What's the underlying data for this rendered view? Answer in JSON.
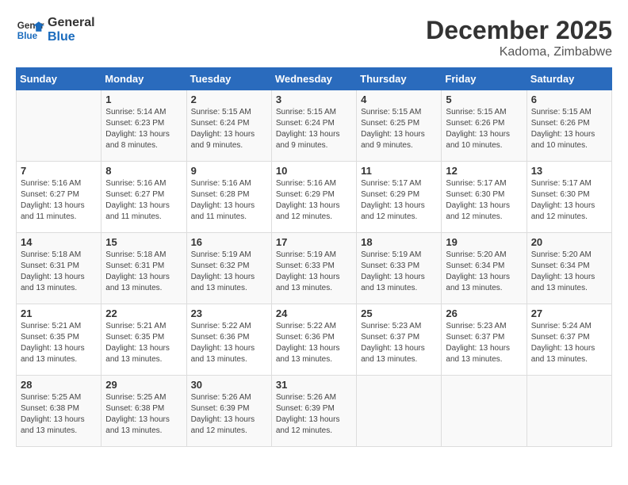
{
  "logo": {
    "line1": "General",
    "line2": "Blue"
  },
  "title": "December 2025",
  "location": "Kadoma, Zimbabwe",
  "days_header": [
    "Sunday",
    "Monday",
    "Tuesday",
    "Wednesday",
    "Thursday",
    "Friday",
    "Saturday"
  ],
  "weeks": [
    [
      {
        "day": "",
        "info": ""
      },
      {
        "day": "1",
        "info": "Sunrise: 5:14 AM\nSunset: 6:23 PM\nDaylight: 13 hours\nand 8 minutes."
      },
      {
        "day": "2",
        "info": "Sunrise: 5:15 AM\nSunset: 6:24 PM\nDaylight: 13 hours\nand 9 minutes."
      },
      {
        "day": "3",
        "info": "Sunrise: 5:15 AM\nSunset: 6:24 PM\nDaylight: 13 hours\nand 9 minutes."
      },
      {
        "day": "4",
        "info": "Sunrise: 5:15 AM\nSunset: 6:25 PM\nDaylight: 13 hours\nand 9 minutes."
      },
      {
        "day": "5",
        "info": "Sunrise: 5:15 AM\nSunset: 6:26 PM\nDaylight: 13 hours\nand 10 minutes."
      },
      {
        "day": "6",
        "info": "Sunrise: 5:15 AM\nSunset: 6:26 PM\nDaylight: 13 hours\nand 10 minutes."
      }
    ],
    [
      {
        "day": "7",
        "info": "Sunrise: 5:16 AM\nSunset: 6:27 PM\nDaylight: 13 hours\nand 11 minutes."
      },
      {
        "day": "8",
        "info": "Sunrise: 5:16 AM\nSunset: 6:27 PM\nDaylight: 13 hours\nand 11 minutes."
      },
      {
        "day": "9",
        "info": "Sunrise: 5:16 AM\nSunset: 6:28 PM\nDaylight: 13 hours\nand 11 minutes."
      },
      {
        "day": "10",
        "info": "Sunrise: 5:16 AM\nSunset: 6:29 PM\nDaylight: 13 hours\nand 12 minutes."
      },
      {
        "day": "11",
        "info": "Sunrise: 5:17 AM\nSunset: 6:29 PM\nDaylight: 13 hours\nand 12 minutes."
      },
      {
        "day": "12",
        "info": "Sunrise: 5:17 AM\nSunset: 6:30 PM\nDaylight: 13 hours\nand 12 minutes."
      },
      {
        "day": "13",
        "info": "Sunrise: 5:17 AM\nSunset: 6:30 PM\nDaylight: 13 hours\nand 12 minutes."
      }
    ],
    [
      {
        "day": "14",
        "info": "Sunrise: 5:18 AM\nSunset: 6:31 PM\nDaylight: 13 hours\nand 13 minutes."
      },
      {
        "day": "15",
        "info": "Sunrise: 5:18 AM\nSunset: 6:31 PM\nDaylight: 13 hours\nand 13 minutes."
      },
      {
        "day": "16",
        "info": "Sunrise: 5:19 AM\nSunset: 6:32 PM\nDaylight: 13 hours\nand 13 minutes."
      },
      {
        "day": "17",
        "info": "Sunrise: 5:19 AM\nSunset: 6:33 PM\nDaylight: 13 hours\nand 13 minutes."
      },
      {
        "day": "18",
        "info": "Sunrise: 5:19 AM\nSunset: 6:33 PM\nDaylight: 13 hours\nand 13 minutes."
      },
      {
        "day": "19",
        "info": "Sunrise: 5:20 AM\nSunset: 6:34 PM\nDaylight: 13 hours\nand 13 minutes."
      },
      {
        "day": "20",
        "info": "Sunrise: 5:20 AM\nSunset: 6:34 PM\nDaylight: 13 hours\nand 13 minutes."
      }
    ],
    [
      {
        "day": "21",
        "info": "Sunrise: 5:21 AM\nSunset: 6:35 PM\nDaylight: 13 hours\nand 13 minutes."
      },
      {
        "day": "22",
        "info": "Sunrise: 5:21 AM\nSunset: 6:35 PM\nDaylight: 13 hours\nand 13 minutes."
      },
      {
        "day": "23",
        "info": "Sunrise: 5:22 AM\nSunset: 6:36 PM\nDaylight: 13 hours\nand 13 minutes."
      },
      {
        "day": "24",
        "info": "Sunrise: 5:22 AM\nSunset: 6:36 PM\nDaylight: 13 hours\nand 13 minutes."
      },
      {
        "day": "25",
        "info": "Sunrise: 5:23 AM\nSunset: 6:37 PM\nDaylight: 13 hours\nand 13 minutes."
      },
      {
        "day": "26",
        "info": "Sunrise: 5:23 AM\nSunset: 6:37 PM\nDaylight: 13 hours\nand 13 minutes."
      },
      {
        "day": "27",
        "info": "Sunrise: 5:24 AM\nSunset: 6:37 PM\nDaylight: 13 hours\nand 13 minutes."
      }
    ],
    [
      {
        "day": "28",
        "info": "Sunrise: 5:25 AM\nSunset: 6:38 PM\nDaylight: 13 hours\nand 13 minutes."
      },
      {
        "day": "29",
        "info": "Sunrise: 5:25 AM\nSunset: 6:38 PM\nDaylight: 13 hours\nand 13 minutes."
      },
      {
        "day": "30",
        "info": "Sunrise: 5:26 AM\nSunset: 6:39 PM\nDaylight: 13 hours\nand 12 minutes."
      },
      {
        "day": "31",
        "info": "Sunrise: 5:26 AM\nSunset: 6:39 PM\nDaylight: 13 hours\nand 12 minutes."
      },
      {
        "day": "",
        "info": ""
      },
      {
        "day": "",
        "info": ""
      },
      {
        "day": "",
        "info": ""
      }
    ]
  ]
}
